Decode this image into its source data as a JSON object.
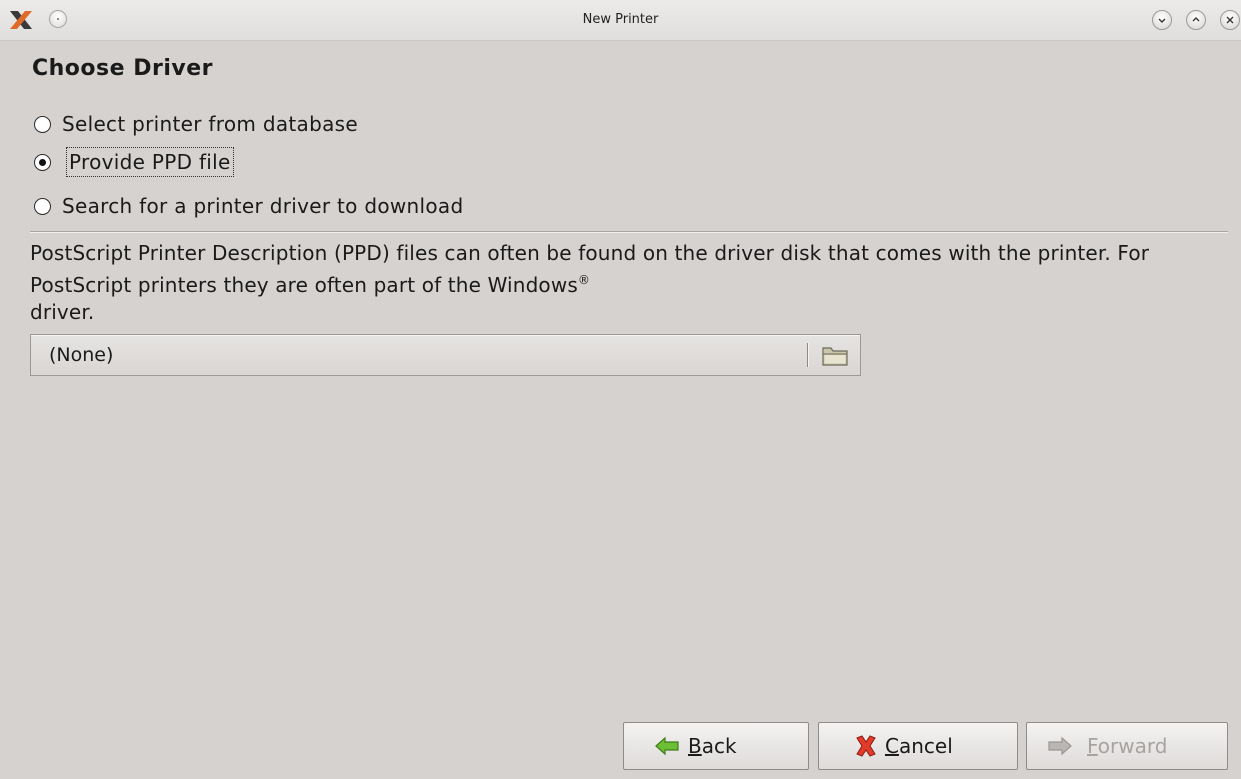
{
  "window": {
    "title": "New Printer",
    "app_icon": "x-logo-icon",
    "menu_button": "window-menu-icon",
    "controls": [
      "minimize-icon",
      "maximize-icon",
      "close-icon"
    ]
  },
  "page": {
    "heading": "Choose Driver"
  },
  "driver_options": {
    "selected_index": 1,
    "items": [
      {
        "label": "Select printer from database",
        "checked": false
      },
      {
        "label": "Provide PPD file",
        "checked": true
      },
      {
        "label": "Search for a printer driver to download",
        "checked": false
      }
    ]
  },
  "description": {
    "text": "PostScript Printer Description (PPD) files can often be found on the driver disk that comes with the printer. For PostScript printers they are often part of the Windows",
    "trademark": "®",
    "suffix": " driver."
  },
  "file_chooser": {
    "value": "(None)",
    "icon": "folder-icon"
  },
  "buttons": {
    "back": {
      "mnemonic": "B",
      "rest": "ack",
      "icon": "arrow-left-icon",
      "enabled": true
    },
    "cancel": {
      "mnemonic": "C",
      "rest": "ancel",
      "icon": "cancel-icon",
      "enabled": true
    },
    "forward": {
      "mnemonic": "F",
      "rest": "orward",
      "icon": "arrow-right-icon",
      "enabled": false
    }
  },
  "colors": {
    "background": "#d6d2d0",
    "arrow_green": "#5fae2c",
    "cancel_red": "#d62a1e",
    "disabled_text": "#a6a3a1"
  }
}
